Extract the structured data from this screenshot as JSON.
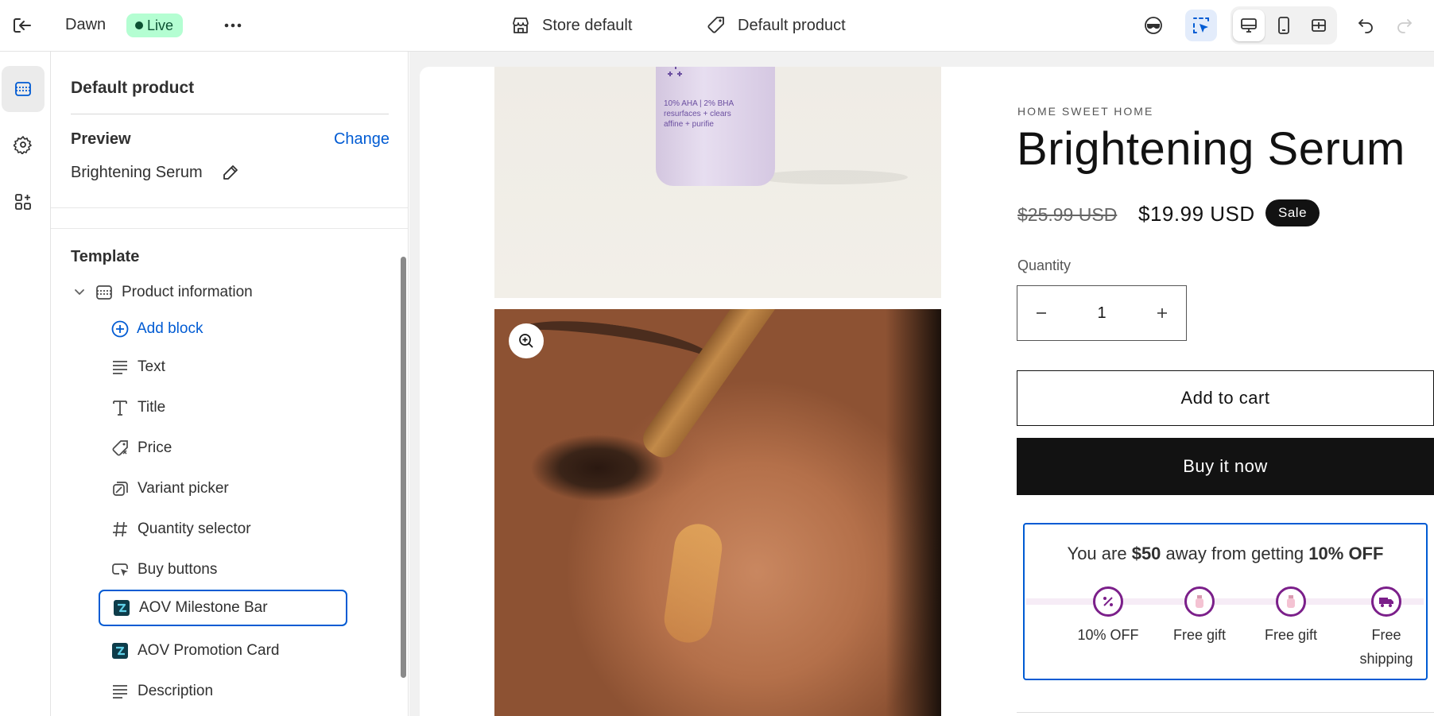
{
  "topbar": {
    "theme_name": "Dawn",
    "status_badge": "Live",
    "store_context": "Store default",
    "template_context": "Default product"
  },
  "rail": {
    "items": [
      {
        "name": "sections",
        "active": true
      },
      {
        "name": "settings",
        "active": false
      },
      {
        "name": "apps",
        "active": false
      }
    ]
  },
  "sidebar": {
    "title": "Default product",
    "preview_label": "Preview",
    "change_link": "Change",
    "preview_product": "Brightening Serum",
    "template_label": "Template",
    "section_name": "Product information",
    "add_block": "Add block",
    "blocks": [
      {
        "label": "Text",
        "icon": "text-lines-icon"
      },
      {
        "label": "Title",
        "icon": "title-t-icon"
      },
      {
        "label": "Price",
        "icon": "price-tag-icon"
      },
      {
        "label": "Variant picker",
        "icon": "variant-icon"
      },
      {
        "label": "Quantity selector",
        "icon": "hash-icon"
      },
      {
        "label": "Buy buttons",
        "icon": "cursor-window-icon"
      },
      {
        "label": "AOV Milestone Bar",
        "icon": "app-logo-icon",
        "selected": true
      },
      {
        "label": "AOV Promotion Card",
        "icon": "app-logo-icon"
      },
      {
        "label": "Description",
        "icon": "text-lines-icon"
      }
    ]
  },
  "product": {
    "bottle_label": "10% AHA | 2% BHA\nresurfaces + clears\naffine + purifie",
    "vendor": "HOME SWEET HOME",
    "title": "Brightening Serum",
    "compare_price": "$25.99 USD",
    "price": "$19.99 USD",
    "sale_badge": "Sale",
    "quantity_label": "Quantity",
    "quantity_value": "1",
    "add_to_cart": "Add to cart",
    "buy_now": "Buy it now"
  },
  "aov_bar": {
    "msg_prefix": "You are ",
    "msg_amount": "$50",
    "msg_middle": " away from getting ",
    "msg_reward": "10% OFF",
    "milestones": [
      {
        "label": "10% OFF",
        "icon": "percent-icon"
      },
      {
        "label": "Free gift",
        "icon": "gift-bottle-icon"
      },
      {
        "label": "Free gift",
        "icon": "gift-bottle-icon"
      },
      {
        "label": "Free shipping",
        "icon": "truck-icon"
      }
    ]
  },
  "colors": {
    "accent_blue": "#005bd3",
    "live_green": "#b4fed2",
    "milestone_purple": "#7b1f8a"
  }
}
